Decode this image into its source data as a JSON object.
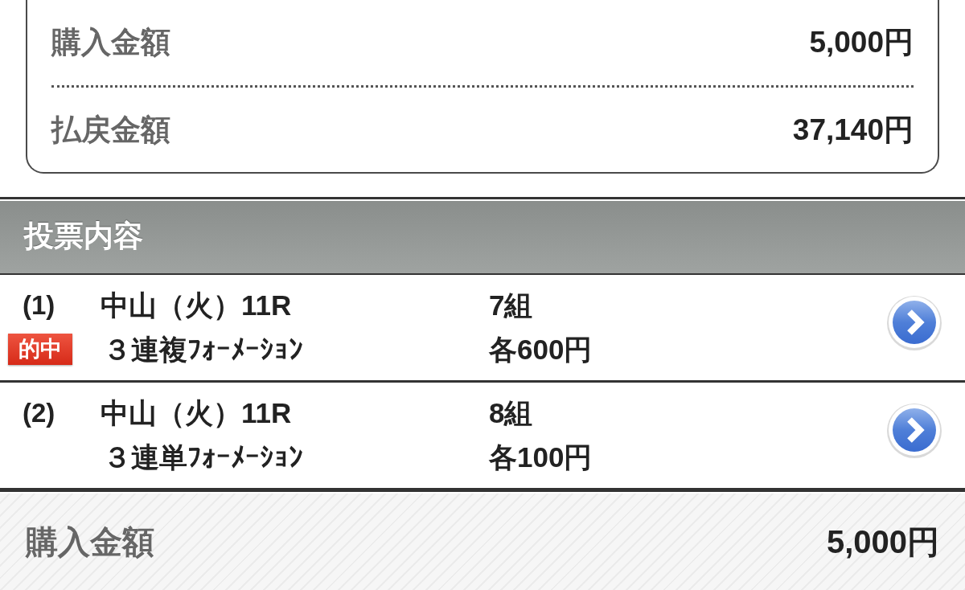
{
  "summary": [
    {
      "label": "購入金額",
      "value": "5,000円"
    },
    {
      "label": "払戻金額",
      "value": "37,140円"
    }
  ],
  "section": {
    "title": "投票内容"
  },
  "bets": [
    {
      "number": "(1)",
      "race": "中山（火）11R",
      "hit": true,
      "badge": "的中",
      "type": "３連複ﾌｫｰﾒｰｼｮﾝ",
      "combos": "7組",
      "stake": "各600円"
    },
    {
      "number": "(2)",
      "race": "中山（火）11R",
      "hit": false,
      "type": "３連単ﾌｫｰﾒｰｼｮﾝ",
      "combos": "8組",
      "stake": "各100円"
    }
  ],
  "footer": {
    "label": "購入金額",
    "value": "5,000円"
  }
}
